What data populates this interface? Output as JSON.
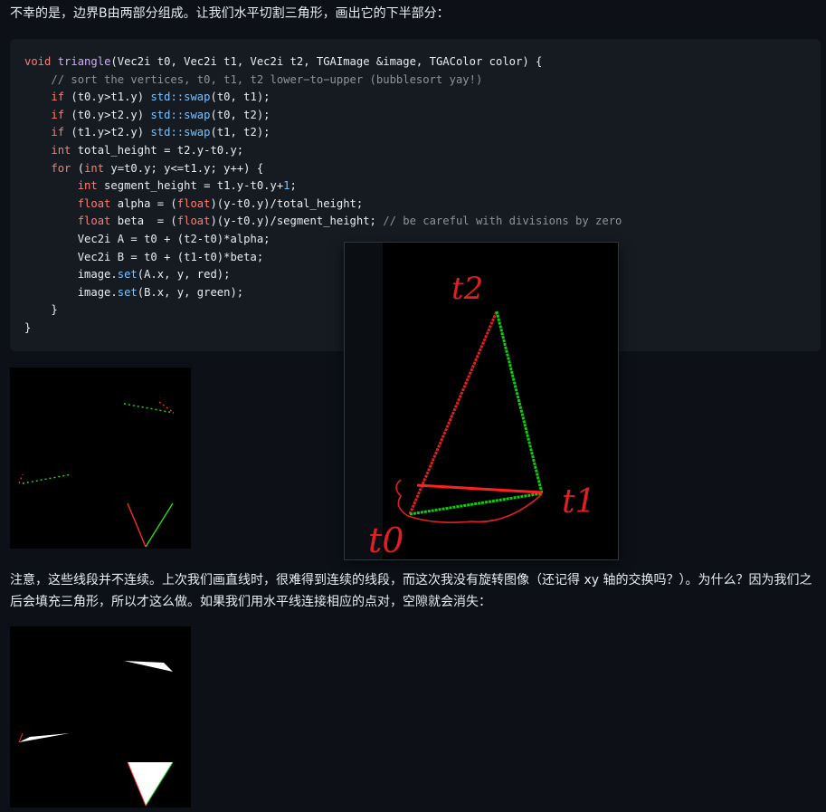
{
  "article": {
    "para1": "不幸的是，边界B由两部分组成。让我们水平切割三角形，画出它的下半部分：",
    "para2": "注意，这些线段并不连续。上次我们画直线时，很难得到连续的线段，而这次我没有旋转图像（还记得 xy 轴的交换吗？）。为什么？因为我们之后会填充三角形，所以才这么做。如果我们用水平线连接相应的点对，空隙就会消失："
  },
  "code": {
    "l1_void": "void",
    "l1_fn": "triangle",
    "l1_rest": "(Vec2i t0, Vec2i t1, Vec2i t2, TGAImage &image, TGAColor color) {",
    "l2_comment": "// sort the vertices, t0, t1, t2 lower−to−upper (bubblesort yay!)",
    "l3_if": "if",
    "l3_cond": " (t0.y>t1.y) ",
    "l3_ns": "std::swap",
    "l3_args": "(t0, t1);",
    "l4_if": "if",
    "l4_cond": " (t0.y>t2.y) ",
    "l4_ns": "std::swap",
    "l4_args": "(t0, t2);",
    "l5_if": "if",
    "l5_cond": " (t1.y>t2.y) ",
    "l5_ns": "std::swap",
    "l5_args": "(t1, t2);",
    "l6_int": "int",
    "l6_rest": " total_height = t2.y-t0.y;",
    "l7_for": "for",
    "l7_a": " (",
    "l7_int": "int",
    "l7_rest": " y=t0.y; y<=t1.y; y++) {",
    "l8_int": "int",
    "l8_rest": " segment_height = t1.y-t0.y+",
    "l8_num": "1",
    "l8_end": ";",
    "l9_float": "float",
    "l9_a": " alpha = (",
    "l9_cast": "float",
    "l9_rest": ")(y-t0.y)/total_height;",
    "l10_float": "float",
    "l10_a": " beta  = (",
    "l10_cast": "float",
    "l10_rest": ")(y-t0.y)/segment_height; ",
    "l10_comment": "// be careful with divisions by zero",
    "l11": "Vec2i A = t0 + (t2-t0)*alpha;",
    "l12": "Vec2i B = t0 + (t1-t0)*beta;",
    "l13_a": "image.",
    "l13_set": "set",
    "l13_rest": "(A.x, y, red);",
    "l14_a": "image.",
    "l14_set": "set",
    "l14_rest": "(B.x, y, green);",
    "l15": "}",
    "l16": "}"
  },
  "sketch": {
    "label_t0": "t0",
    "label_t1": "t1",
    "label_t2": "t2"
  },
  "colors": {
    "red": "#ff2a2a",
    "green": "#22dd22",
    "sketch_red": "#e02020",
    "sketch_green": "#10cc10"
  }
}
